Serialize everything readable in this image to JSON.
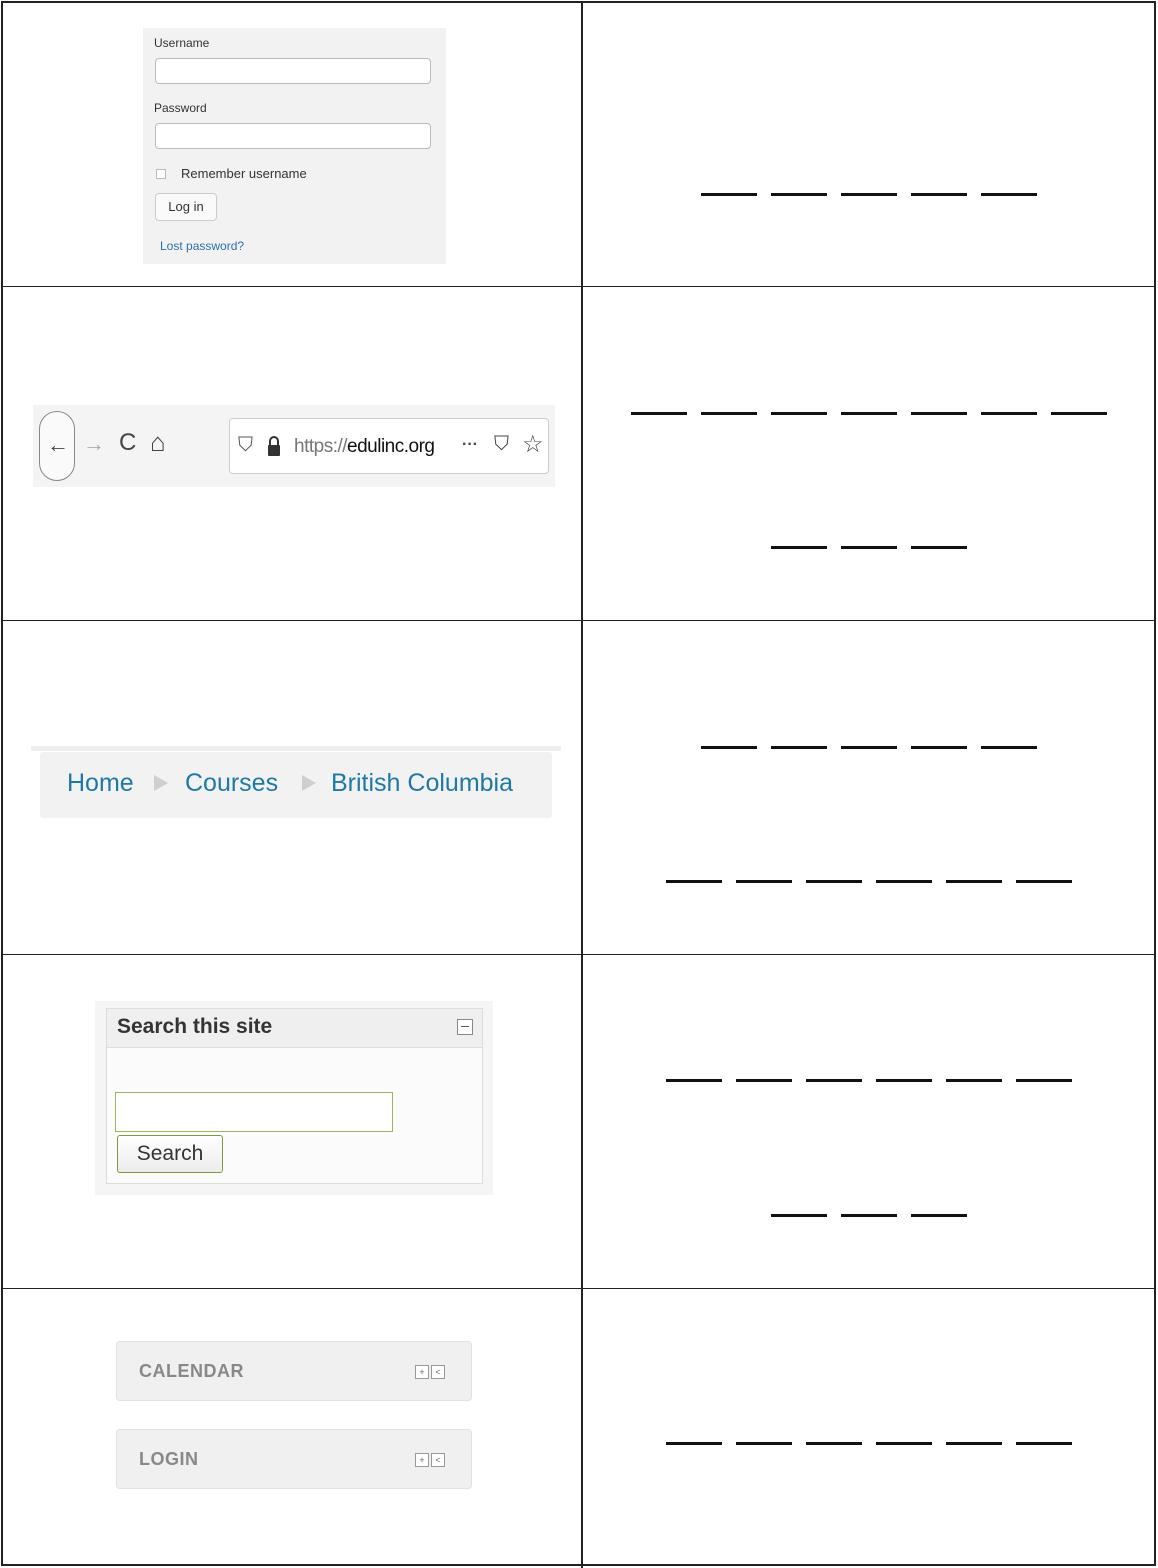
{
  "login": {
    "username_label": "Username",
    "password_label": "Password",
    "remember_label": "Remember username",
    "login_button": "Log in",
    "lost_password": "Lost password?"
  },
  "browser": {
    "back_icon": "←",
    "forward_icon": "→",
    "reload_icon": "C",
    "home_icon": "⌂",
    "shield_icon": "⛉",
    "url_protocol": "https://",
    "url_domain": "edulinc.org",
    "more_icon": "···",
    "pocket_icon": "⛉",
    "star_icon": "☆"
  },
  "breadcrumb": {
    "items": [
      "Home",
      "Courses",
      "British Columbia"
    ]
  },
  "search_block": {
    "title": "Search this site",
    "button": "Search",
    "input_value": ""
  },
  "blocks": {
    "calendar_title": "CALENDAR",
    "login_title": "LOGIN"
  },
  "worksheet": {
    "answer_blanks": [
      [
        5
      ],
      [
        7,
        3
      ],
      [
        5,
        6
      ],
      [
        6,
        3
      ],
      [
        6
      ]
    ]
  }
}
